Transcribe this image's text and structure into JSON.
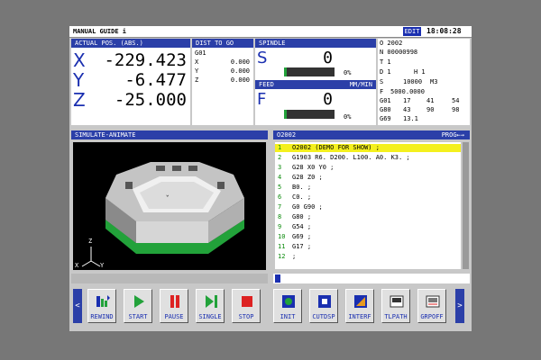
{
  "title": "MANUAL GUIDE i",
  "mode_badge": "EDIT",
  "clock": "18:08:28",
  "actual_pos": {
    "header": "ACTUAL POS. (ABS.)",
    "axes": [
      {
        "axis": "X",
        "value": "-229.423"
      },
      {
        "axis": "Y",
        "value": "-6.477"
      },
      {
        "axis": "Z",
        "value": "-25.000"
      }
    ]
  },
  "dist_to_go": {
    "header": "DIST TO GO",
    "code": "G01",
    "rows": [
      {
        "axis": "X",
        "value": "0.000"
      },
      {
        "axis": "Y",
        "value": "0.000"
      },
      {
        "axis": "Z",
        "value": "0.000"
      }
    ]
  },
  "spindle": {
    "header": "SPINDLE",
    "letter": "S",
    "value": "0",
    "percent": "0%",
    "load_fraction": 0.05
  },
  "feed": {
    "header": "FEED",
    "unit": "MM/MIN",
    "letter": "F",
    "value": "0",
    "percent": "0%",
    "load_fraction": 0.05
  },
  "modal": {
    "o": "O 2002",
    "n": "N 00000998",
    "t": "T 1",
    "d_label": "D 1",
    "h_label": "H 1",
    "s_label": "S",
    "s_value": "10000",
    "m_value": "M3",
    "f_label": "F",
    "f_value": "5000.0000",
    "g_rows": [
      [
        "G01",
        "17",
        "41",
        "54"
      ],
      [
        "G80",
        "43",
        "90",
        "98"
      ],
      [
        "G69",
        "13.1",
        "",
        ""
      ]
    ]
  },
  "simulate": {
    "header": "SIMULATE-ANIMATE",
    "axis_labels": {
      "z": "Z",
      "x": "X",
      "y": "Y"
    }
  },
  "program": {
    "header": "O2002",
    "prog_label": "PROG←→",
    "lines": [
      {
        "n": "1",
        "text": "O2002 (DEMO FOR SHOW) ;"
      },
      {
        "n": "2",
        "text": "G1903 R6. D200. L100. A0. K3. ;"
      },
      {
        "n": "3",
        "text": "G28 X0 Y0 ;"
      },
      {
        "n": "4",
        "text": "G28 Z0 ;"
      },
      {
        "n": "5",
        "text": "B0. ;"
      },
      {
        "n": "6",
        "text": "C0. ;"
      },
      {
        "n": "7",
        "text": "G0 G90 ;"
      },
      {
        "n": "8",
        "text": "G80 ;"
      },
      {
        "n": "9",
        "text": "G54 ;"
      },
      {
        "n": "10",
        "text": "G69 ;"
      },
      {
        "n": "11",
        "text": "G17 ;"
      },
      {
        "n": "12",
        "text": ";"
      }
    ],
    "selected_index": 0
  },
  "softkeys_left": [
    {
      "name": "rewind",
      "label": "REWIND"
    },
    {
      "name": "start",
      "label": "START"
    },
    {
      "name": "pause",
      "label": "PAUSE"
    },
    {
      "name": "single",
      "label": "SINGLE"
    },
    {
      "name": "stop",
      "label": "STOP"
    }
  ],
  "softkeys_right": [
    {
      "name": "init",
      "label": "INIT"
    },
    {
      "name": "cutdsp",
      "label": "CUTDSP"
    },
    {
      "name": "interf",
      "label": "INTERF"
    },
    {
      "name": "tlpath",
      "label": "TLPATH"
    },
    {
      "name": "grpoff",
      "label": "GRPOFF"
    }
  ],
  "nav": {
    "left": "<",
    "right": ">"
  },
  "colors": {
    "header_blue": "#2b3fa8",
    "highlight_yellow": "#f4f01e",
    "line_green": "#0a8a0a",
    "part_green": "#22a23a"
  }
}
